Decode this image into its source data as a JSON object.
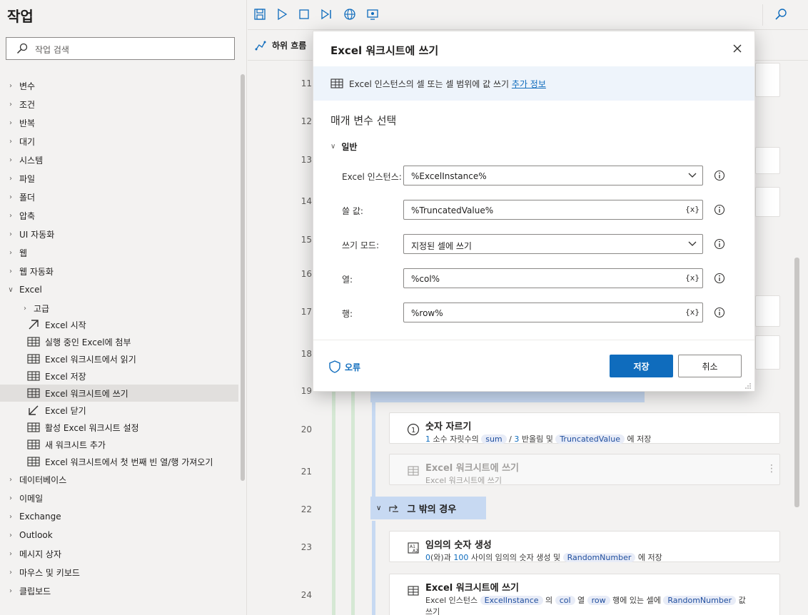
{
  "left": {
    "title": "작업",
    "search_placeholder": "작업 검색",
    "categories": [
      {
        "label": "변수"
      },
      {
        "label": "조건"
      },
      {
        "label": "반복"
      },
      {
        "label": "대기"
      },
      {
        "label": "시스템"
      },
      {
        "label": "파일"
      },
      {
        "label": "폴더"
      },
      {
        "label": "압축"
      },
      {
        "label": "UI 자동화"
      },
      {
        "label": "웹"
      },
      {
        "label": "웹 자동화"
      },
      {
        "label": "Excel"
      }
    ],
    "excel_sub": "고급",
    "excel_actions": [
      {
        "label": "Excel 시작",
        "icon": "launch-arrow-icon"
      },
      {
        "label": "실행 중인 Excel에 첨부",
        "icon": "excel-icon"
      },
      {
        "label": "Excel 워크시트에서 읽기",
        "icon": "excel-icon"
      },
      {
        "label": "Excel 저장",
        "icon": "excel-icon"
      },
      {
        "label": "Excel 워크시트에 쓰기",
        "icon": "excel-icon"
      },
      {
        "label": "Excel 닫기",
        "icon": "close-arrow-icon"
      },
      {
        "label": "활성 Excel 워크시트 설정",
        "icon": "excel-icon"
      },
      {
        "label": "새 워크시트 추가",
        "icon": "excel-icon"
      },
      {
        "label": "Excel 워크시트에서 첫 번째 빈 열/행 가져오기",
        "icon": "excel-icon"
      }
    ],
    "after": [
      {
        "label": "데이터베이스"
      },
      {
        "label": "이메일"
      },
      {
        "label": "Exchange"
      },
      {
        "label": "Outlook"
      },
      {
        "label": "메시지 상자"
      },
      {
        "label": "마우스 및 키보드"
      },
      {
        "label": "클립보드"
      }
    ]
  },
  "subflow_tab": "하위 흐름",
  "canvas": {
    "line_numbers": [
      "11",
      "12",
      "13",
      "14",
      "15",
      "16",
      "17",
      "18",
      "19",
      "20",
      "21",
      "22",
      "23",
      "24"
    ],
    "card20": {
      "title": "숫자 자르기",
      "d1": "1",
      "d2": " 소수 자릿수의 ",
      "d3": "sum",
      "d4": " / ",
      "d5": "3",
      "d6": " 반올림 및 ",
      "d7": "TruncatedValue",
      "d8": " 에 저장"
    },
    "card21": {
      "title": "Excel 워크시트에 쓰기",
      "desc": "Excel 워크시트에 쓰기"
    },
    "else_label": "그 밖의 경우",
    "card23": {
      "title": "임의의 숫자 생성",
      "d1": "0",
      "d2": "(와)과 ",
      "d3": "100",
      "d4": " 사이의 임의의 숫자 생성 및 ",
      "d5": "RandomNumber",
      "d6": " 에 저장"
    },
    "card24": {
      "title": "Excel 워크시트에 쓰기",
      "d1": "Excel 인스턴스 ",
      "d2": "ExcelInstance",
      "d3": " 의 ",
      "d4": "col",
      "d5": " 열 ",
      "d6": "row",
      "d7": " 행에 있는 셀에 ",
      "d8": "RandomNumber",
      "d9": " 값",
      "d10": "쓰기"
    }
  },
  "modal": {
    "title": "Excel 워크시트에 쓰기",
    "info_text": "Excel 인스턴스의 셀 또는 셀 범위에 값 쓰기 ",
    "info_link": "추가 정보",
    "section": "매개 변수 선택",
    "group": "일반",
    "fields": [
      {
        "label": "Excel 인스턴스:",
        "value": "%ExcelInstance%",
        "kind": "dropdown"
      },
      {
        "label": "쓸 값:",
        "value": "%TruncatedValue%",
        "kind": "var"
      },
      {
        "label": "쓰기 모드:",
        "value": "지정된 셀에 쓰기",
        "kind": "dropdown"
      },
      {
        "label": "열:",
        "value": "%col%",
        "kind": "var"
      },
      {
        "label": "행:",
        "value": "%row%",
        "kind": "var"
      }
    ],
    "var_glyph": "{x}",
    "errors_label": "오류",
    "save_label": "저장",
    "cancel_label": "취소"
  },
  "colors": {
    "accent": "#0f6cbd",
    "group_header": "#c7d9f2",
    "flow_bar": "#d5e8d4"
  }
}
